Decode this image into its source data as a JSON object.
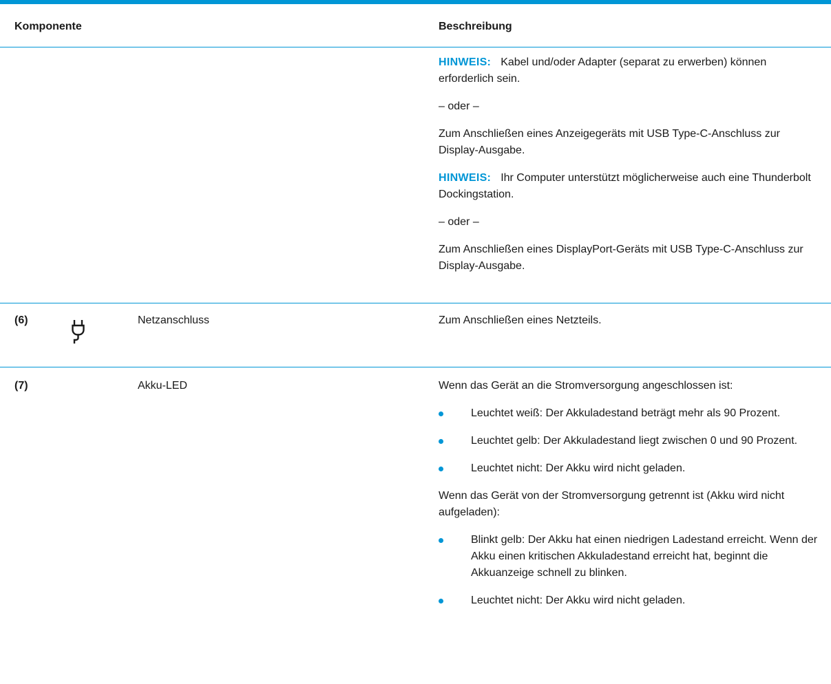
{
  "table": {
    "header": {
      "component": "Komponente",
      "description": "Beschreibung"
    },
    "continued": {
      "note1_label": "HINWEIS:",
      "note1_text": "Kabel und/oder Adapter (separat zu erwerben) können erforderlich sein.",
      "or1": "– oder –",
      "para1": "Zum Anschließen eines Anzeigegeräts mit USB Type-C-Anschluss zur Display-Ausgabe.",
      "note2_label": "HINWEIS:",
      "note2_text": "Ihr Computer unterstützt möglicherweise auch eine Thunderbolt Dockingstation.",
      "or2": "– oder –",
      "para2": "Zum Anschließen eines DisplayPort-Geräts mit USB Type-C-Anschluss zur Display-Ausgabe."
    },
    "row6": {
      "number": "(6)",
      "icon": "power-plug-icon",
      "name": "Netzanschluss",
      "description": "Zum Anschließen eines Netzteils."
    },
    "row7": {
      "number": "(7)",
      "name": "Akku-LED",
      "intro_connected": "Wenn das Gerät an die Stromversorgung angeschlossen ist:",
      "connected_bullets": [
        "Leuchtet weiß: Der Akkuladestand beträgt mehr als 90 Prozent.",
        "Leuchtet gelb: Der Akkuladestand liegt zwischen 0 und 90 Prozent.",
        "Leuchtet nicht: Der Akku wird nicht geladen."
      ],
      "intro_disconnected": "Wenn das Gerät von der Stromversorgung getrennt ist (Akku wird nicht aufgeladen):",
      "disconnected_bullets": [
        "Blinkt gelb: Der Akku hat einen niedrigen Ladestand erreicht. Wenn der Akku einen kritischen Akkuladestand erreicht hat, beginnt die Akkuanzeige schnell zu blinken.",
        "Leuchtet nicht: Der Akku wird nicht geladen."
      ]
    }
  },
  "colors": {
    "accent": "#0096d6",
    "text": "#1a1a1a"
  }
}
